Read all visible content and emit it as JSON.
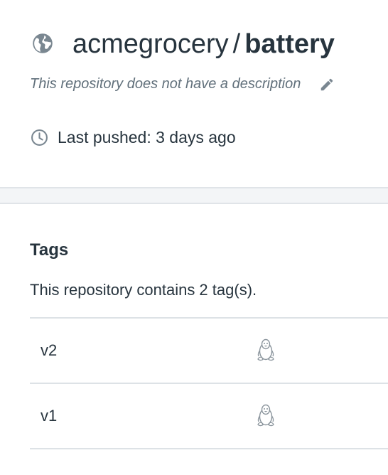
{
  "repo": {
    "namespace": "acmegrocery",
    "separator": "/",
    "name": "battery",
    "description": "This repository does not have a description",
    "last_pushed": "Last pushed: 3 days ago",
    "visibility_icon": "globe-icon"
  },
  "tags": {
    "heading": "Tags",
    "summary": "This repository contains 2 tag(s).",
    "items": [
      {
        "name": "v2",
        "os_icon": "linux-icon"
      },
      {
        "name": "v1",
        "os_icon": "linux-icon"
      }
    ]
  },
  "colors": {
    "text": "#27343e",
    "muted": "#61707b",
    "icon": "#7a8791",
    "divider": "#dde2e6",
    "section_bg": "#f3f5f7"
  }
}
